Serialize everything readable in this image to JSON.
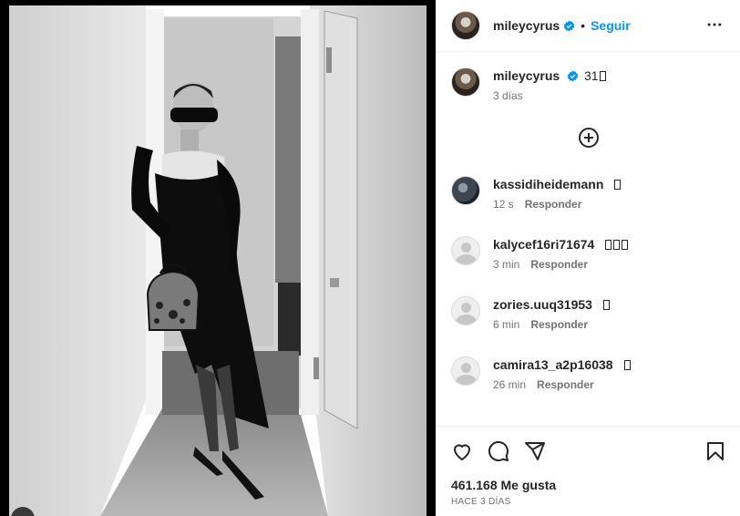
{
  "post": {
    "author": "mileycyrus",
    "follow_label": "Seguir",
    "separator": "•",
    "more_icon": "more-horizontal-icon",
    "verified_icon": "verified-badge-icon"
  },
  "media": {
    "description_icon": "post-photo"
  },
  "caption": {
    "username": "mileycyrus",
    "text": "31",
    "emoji_count": 1,
    "time": "3 días"
  },
  "load_more": {
    "icon": "plus-circle-icon"
  },
  "comments": [
    {
      "username": "kassidiheidemann",
      "text": "",
      "emoji_count": 1,
      "time": "12 s",
      "reply": "Responder",
      "avatar": "dark"
    },
    {
      "username": "kalycef16ri71674",
      "text": "",
      "emoji_count": 3,
      "time": "3 min",
      "reply": "Responder",
      "avatar": "gray"
    },
    {
      "username": "zories.uuq31953",
      "text": "",
      "emoji_count": 1,
      "time": "6 min",
      "reply": "Responder",
      "avatar": "gray"
    },
    {
      "username": "camira13_a2p16038",
      "text": "",
      "emoji_count": 1,
      "time": "26 min",
      "reply": "Responder",
      "avatar": "gray"
    }
  ],
  "actions": {
    "like_icon": "heart-icon",
    "comment_icon": "comment-icon",
    "share_icon": "share-icon",
    "save_icon": "bookmark-icon",
    "likes": "461.168 Me gusta",
    "date": "HACE 3 DÍAS"
  }
}
